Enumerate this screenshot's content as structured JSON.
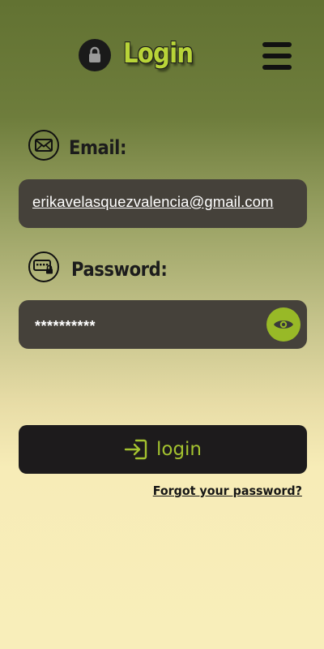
{
  "header": {
    "title": "Login",
    "lock_icon": "lock-icon",
    "menu_icon": "hamburger-menu-icon"
  },
  "email": {
    "label": "Email:",
    "icon": "envelope-icon",
    "value": "erikavelasquezvalencia@gmail.com"
  },
  "password": {
    "label": "Password:",
    "icon": "password-keyboard-lock-icon",
    "value": "**********",
    "toggle_icon": "eye-icon"
  },
  "login_button": {
    "label": "login",
    "icon": "login-arrow-icon"
  },
  "forgot_password": {
    "label": "Forgot your password?"
  },
  "colors": {
    "accent": "#98b927",
    "field_background": "#45413a",
    "button_background": "#1d1b1c",
    "gradient_top": "#627232",
    "gradient_bottom": "#f8eeba"
  }
}
